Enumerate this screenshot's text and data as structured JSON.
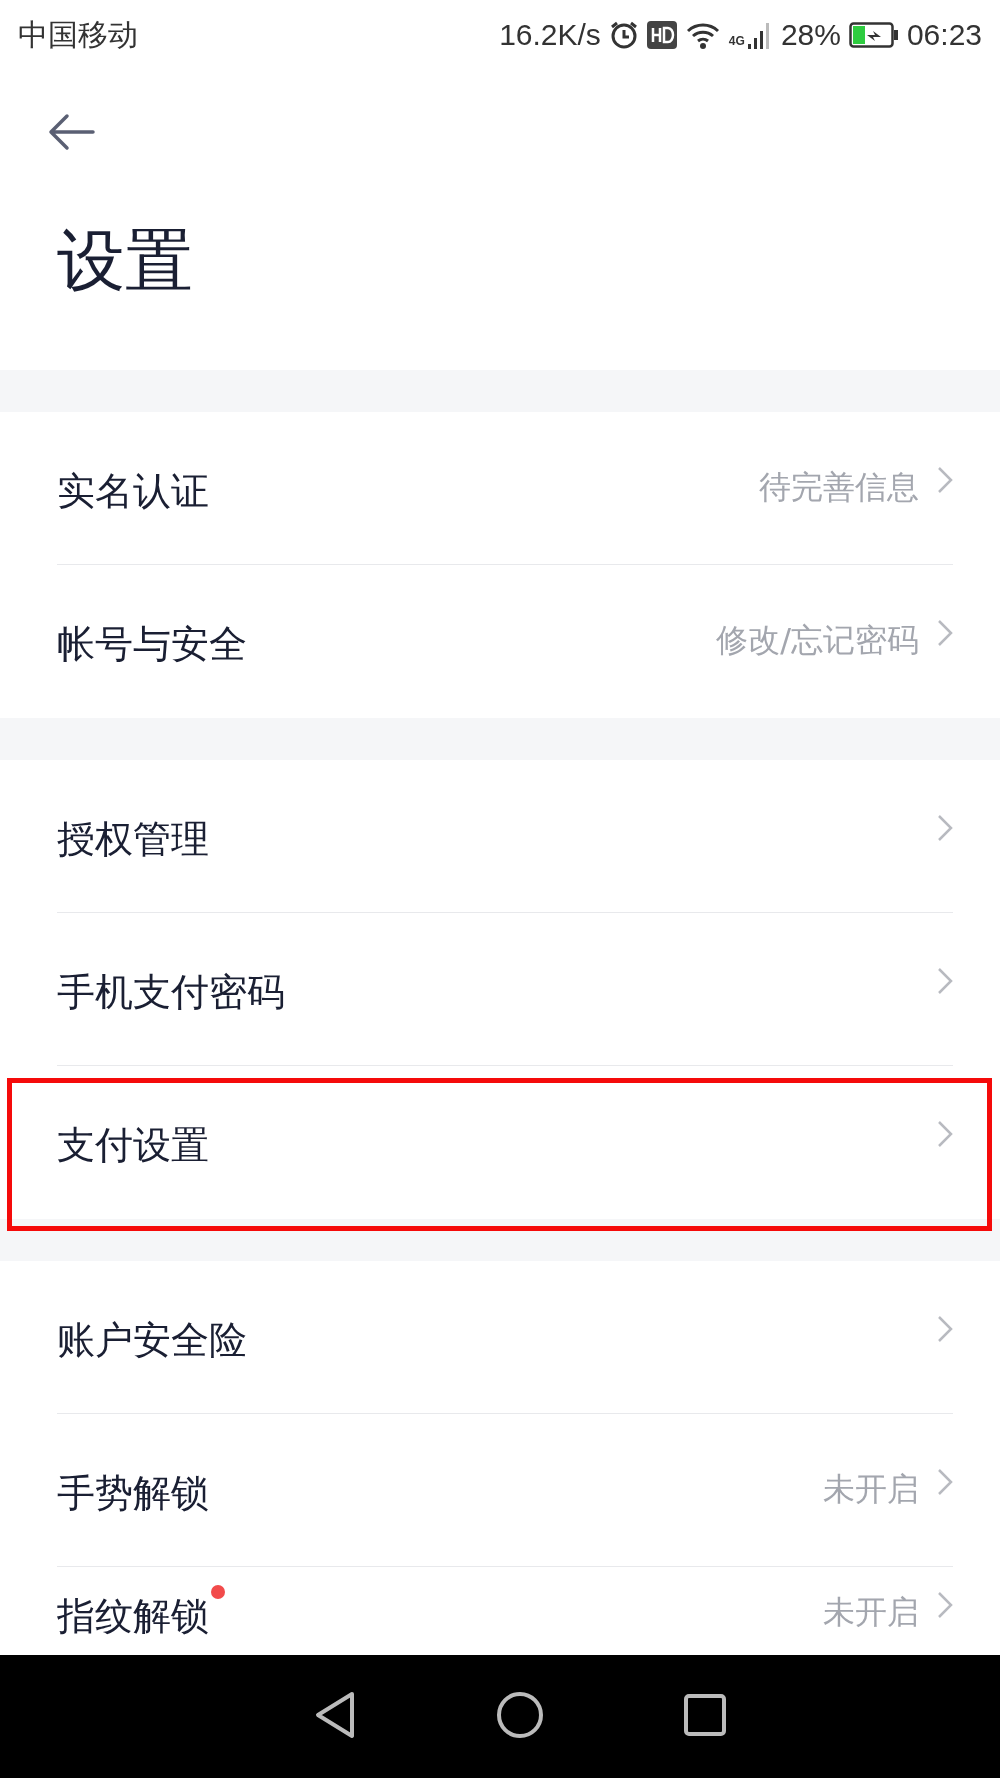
{
  "status_bar": {
    "carrier": "中国移动",
    "speed": "16.2K/s",
    "network": "4G",
    "battery": "28%",
    "time": "06:23"
  },
  "title": "设置",
  "groups": [
    {
      "items": [
        {
          "label": "实名认证",
          "value": "待完善信息",
          "badge": false,
          "highlighted": false
        },
        {
          "label": "帐号与安全",
          "value": "修改/忘记密码",
          "badge": false,
          "highlighted": false
        }
      ]
    },
    {
      "items": [
        {
          "label": "授权管理",
          "badge": false,
          "highlighted": false
        },
        {
          "label": "手机支付密码",
          "badge": false,
          "highlighted": false
        },
        {
          "label": "支付设置",
          "badge": false,
          "highlighted": true
        }
      ]
    },
    {
      "items": [
        {
          "label": "账户安全险",
          "badge": false,
          "highlighted": false
        },
        {
          "label": "手势解锁",
          "value": "未开启",
          "badge": false,
          "highlighted": false
        },
        {
          "label": "指纹解锁",
          "value": "未开启",
          "badge": true,
          "highlighted": false
        }
      ]
    }
  ]
}
